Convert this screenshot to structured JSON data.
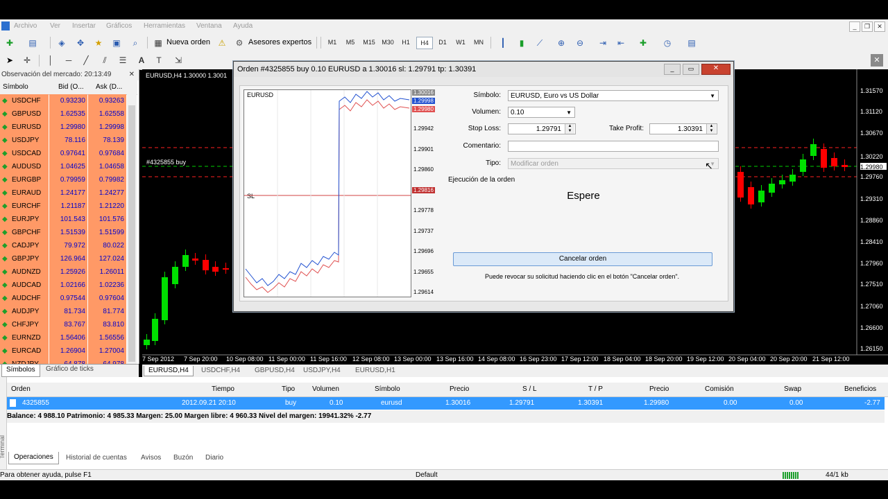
{
  "menu": [
    "Archivo",
    "Ver",
    "Insertar",
    "Gráficos",
    "Herramientas",
    "Ventana",
    "Ayuda"
  ],
  "toolbar": {
    "new_order": "Nueva orden",
    "experts": "Asesores expertos",
    "timeframes": [
      "M1",
      "M5",
      "M15",
      "M30",
      "H1",
      "H4",
      "D1",
      "W1",
      "MN"
    ],
    "selected_timeframe": "H4"
  },
  "market_watch": {
    "title": "Observación del mercado: 20:13:49",
    "headers": {
      "symbol": "Símbolo",
      "bid": "Bid (O...",
      "ask": "Ask (D..."
    },
    "rows": [
      {
        "s": "USDCHF",
        "b": "0.93230",
        "a": "0.93263"
      },
      {
        "s": "GBPUSD",
        "b": "1.62535",
        "a": "1.62558"
      },
      {
        "s": "EURUSD",
        "b": "1.29980",
        "a": "1.29998"
      },
      {
        "s": "USDJPY",
        "b": "78.116",
        "a": "78.139"
      },
      {
        "s": "USDCAD",
        "b": "0.97641",
        "a": "0.97684"
      },
      {
        "s": "AUDUSD",
        "b": "1.04625",
        "a": "1.04658"
      },
      {
        "s": "EURGBP",
        "b": "0.79959",
        "a": "0.79982"
      },
      {
        "s": "EURAUD",
        "b": "1.24177",
        "a": "1.24277"
      },
      {
        "s": "EURCHF",
        "b": "1.21187",
        "a": "1.21220"
      },
      {
        "s": "EURJPY",
        "b": "101.543",
        "a": "101.576"
      },
      {
        "s": "GBPCHF",
        "b": "1.51539",
        "a": "1.51599"
      },
      {
        "s": "CADJPY",
        "b": "79.972",
        "a": "80.022"
      },
      {
        "s": "GBPJPY",
        "b": "126.964",
        "a": "127.024"
      },
      {
        "s": "AUDNZD",
        "b": "1.25926",
        "a": "1.26011"
      },
      {
        "s": "AUDCAD",
        "b": "1.02166",
        "a": "1.02236"
      },
      {
        "s": "AUDCHF",
        "b": "0.97544",
        "a": "0.97604"
      },
      {
        "s": "AUDJPY",
        "b": "81.734",
        "a": "81.774"
      },
      {
        "s": "CHFJPY",
        "b": "83.767",
        "a": "83.810"
      },
      {
        "s": "EURNZD",
        "b": "1.56406",
        "a": "1.56556"
      },
      {
        "s": "EURCAD",
        "b": "1.26904",
        "a": "1.27004"
      },
      {
        "s": "NZDJPY",
        "b": "64.878",
        "a": "64.978"
      }
    ],
    "tabs": [
      "Símbolos",
      "Gráfico de ticks"
    ]
  },
  "chart": {
    "header": "EURUSD,H4 1.30000 1.3001",
    "order_line": "#4325855 buy",
    "price_labels": [
      "1.31570",
      "1.31120",
      "1.30670",
      "1.30220",
      "1.29980",
      "1.29760",
      "1.29310",
      "1.28860",
      "1.28410",
      "1.27960",
      "1.27510",
      "1.27060",
      "1.26600",
      "1.26150"
    ],
    "time_labels": [
      "7 Sep 2012",
      "7 Sep 20:00",
      "10 Sep 08:00",
      "11 Sep 00:00",
      "11 Sep 16:00",
      "12 Sep 08:00",
      "13 Sep 00:00",
      "13 Sep 16:00",
      "14 Sep 08:00",
      "16 Sep 23:00",
      "17 Sep 12:00",
      "18 Sep 04:00",
      "18 Sep 20:00",
      "19 Sep 12:00",
      "20 Sep 04:00",
      "20 Sep 20:00",
      "21 Sep 12:00"
    ],
    "tabs": [
      "EURUSD,H4",
      "USDCHF,H4",
      "GBPUSD,H4",
      "USDJPY,H4",
      "EURUSD,H1"
    ]
  },
  "dialog": {
    "title": "Orden #4325855 buy 0.10 EURUSD a 1.30016 sl: 1.29791 tp: 1.30391",
    "mini_chart": {
      "label": "EURUSD",
      "sl_label": "SL",
      "prices": [
        "1.30016",
        "1.29998",
        "1.29980",
        "1.29942",
        "1.29901",
        "1.29860",
        "1.29816",
        "1.29778",
        "1.29737",
        "1.29696",
        "1.29655",
        "1.29614"
      ]
    },
    "symbol_label": "Símbolo:",
    "symbol_value": "EURUSD, Euro vs US Dollar",
    "volume_label": "Volumen:",
    "volume_value": "0.10",
    "stoploss_label": "Stop Loss:",
    "stoploss_value": "1.29791",
    "takeprofit_label": "Take Profit:",
    "takeprofit_value": "1.30391",
    "comment_label": "Comentario:",
    "comment_value": "",
    "type_label": "Tipo:",
    "type_value": "Modificar orden",
    "exec_label": "Ejecución de la orden",
    "wait_text": "Espere",
    "cancel_button": "Cancelar orden",
    "hint": "Puede revocar su solicitud haciendo clic en el botón \"Cancelar orden\"."
  },
  "terminal": {
    "headers": [
      "Orden",
      "Tiempo",
      "Tipo",
      "Volumen",
      "Símbolo",
      "Precio",
      "S / L",
      "T / P",
      "Precio",
      "Comisión",
      "Swap",
      "Beneficios"
    ],
    "row": [
      "4325855",
      "2012.09.21 20:10",
      "buy",
      "0.10",
      "eurusd",
      "1.30016",
      "1.29791",
      "1.30391",
      "1.29980",
      "0.00",
      "0.00",
      "-2.77"
    ],
    "balance": "Balance: 4 988.10  Patrimonio: 4 985.33  Margen: 25.00  Margen libre: 4 960.33  Nivel del margen: 19941.32%",
    "balance_profit": "-2.77",
    "tabs": [
      "Operaciones",
      "Historial de cuentas",
      "Avisos",
      "Buzón",
      "Diario"
    ],
    "side_label": "Terminal"
  },
  "status": {
    "help": "Para obtener ayuda, pulse F1",
    "profile": "Default",
    "traffic": "44/1 kb"
  },
  "colors": {
    "bull": "#00e000",
    "bear": "#ff0000",
    "row_bg": "#ff9966",
    "bid_text": "#0000cc",
    "selected_row": "#3399ff"
  }
}
